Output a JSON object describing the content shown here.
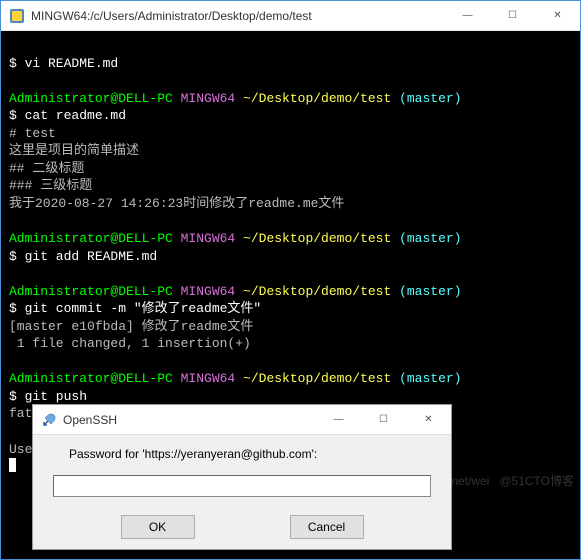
{
  "main_window": {
    "title": "MINGW64:/c/Users/Administrator/Desktop/demo/test"
  },
  "win_controls": {
    "min": "—",
    "max": "☐",
    "close": "✕"
  },
  "term": {
    "l1_cmd": "$ vi README.md",
    "p_user": "Administrator@DELL-PC",
    "p_mingw": " MINGW64 ",
    "p_path": "~/Desktop/demo/test",
    "p_branch": " (master)",
    "cat_cmd": "$ cat readme.md",
    "cat_out1": "# test",
    "cat_out2": "这里是项目的简单描述",
    "cat_out3": "## 二级标题",
    "cat_out4": "### 三级标题",
    "cat_out5": "我于2020-08-27 14:26:23时间修改了readme.me文件",
    "add_cmd": "$ git add README.md",
    "commit_cmd": "$ git commit -m \"修改了readme文件\"",
    "commit_out1": "[master e10fbda] 修改了readme文件",
    "commit_out2": " 1 file changed, 1 insertion(+)",
    "push_cmd": "$ git push",
    "push_err": "fatal: HttpRequestException encountered.",
    "push_blank": "",
    "push_user": "Username for 'https://github.com': yeranyeran"
  },
  "dialog": {
    "title": "OpenSSH",
    "prompt": "Password for 'https://yeranyeran@github.com':",
    "input": "",
    "ok": "OK",
    "cancel": "Cancel",
    "min": "—",
    "max": "☐",
    "close": "✕"
  },
  "watermark": "blog.csdn.net/wei   @51CTO博客"
}
